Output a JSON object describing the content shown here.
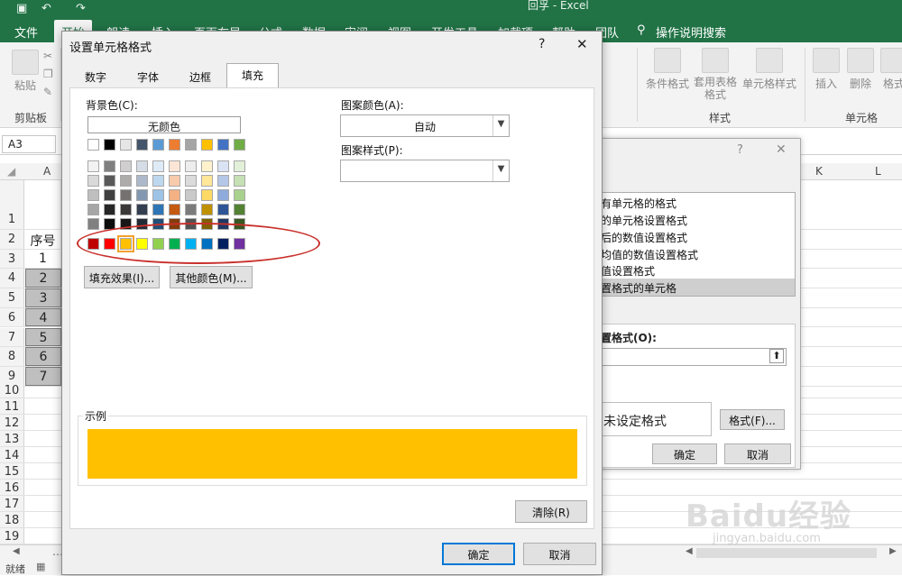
{
  "app": {
    "title": "回孚 - Excel"
  },
  "ribbon": {
    "tabs": [
      "文件",
      "开始",
      "朗读",
      "插入",
      "页面布局",
      "公式",
      "数据",
      "审阅",
      "视图",
      "开发工具",
      "加载项",
      "帮助",
      "团队"
    ],
    "active_tab": "开始",
    "search_label": "操作说明搜索",
    "clipboard": {
      "paste": "粘贴",
      "group": "剪贴板"
    },
    "styles": {
      "conditional": "条件格式",
      "table": "套用表格格式",
      "cell_styles": "单元格样式",
      "group": "样式"
    },
    "cells": {
      "insert": "插入",
      "delete": "删除",
      "format": "格式",
      "group": "单元格"
    }
  },
  "formula_bar": {
    "name_box": "A3"
  },
  "sheet": {
    "col_headers": [
      "A",
      "K",
      "L"
    ],
    "rows": [
      {
        "num": "1",
        "a": ""
      },
      {
        "num": "2",
        "a": "序号"
      },
      {
        "num": "3",
        "a": "1"
      },
      {
        "num": "4",
        "a": "2"
      },
      {
        "num": "5",
        "a": "3"
      },
      {
        "num": "6",
        "a": "4"
      },
      {
        "num": "7",
        "a": "5"
      },
      {
        "num": "8",
        "a": "6"
      },
      {
        "num": "9",
        "a": "7"
      },
      {
        "num": "10",
        "a": ""
      },
      {
        "num": "11",
        "a": ""
      },
      {
        "num": "12",
        "a": ""
      },
      {
        "num": "13",
        "a": ""
      },
      {
        "num": "14",
        "a": ""
      },
      {
        "num": "15",
        "a": ""
      },
      {
        "num": "16",
        "a": ""
      },
      {
        "num": "17",
        "a": ""
      },
      {
        "num": "18",
        "a": ""
      },
      {
        "num": "19",
        "a": ""
      }
    ],
    "status": "就绪"
  },
  "bg_dialog": {
    "rule_types": [
      "有单元格的格式",
      "的单元格设置格式",
      "后的数值设置格式",
      "均值的数值设置格式",
      "值设置格式",
      "置格式的单元格"
    ],
    "format_label": "置格式(O):",
    "preview_text": "未设定格式",
    "format_button": "格式(F)...",
    "ok": "确定",
    "cancel": "取消"
  },
  "dialog": {
    "title": "设置单元格格式",
    "help": "?",
    "close": "✕",
    "tabs": [
      "数字",
      "字体",
      "边框",
      "填充"
    ],
    "active_tab": "填充",
    "bg_color_label": "背景色(C):",
    "no_color": "无颜色",
    "theme_top": [
      "#ffffff",
      "#000000",
      "#e7e6e6",
      "#44546a",
      "#5b9bd5",
      "#ed7d31",
      "#a5a5a5",
      "#ffc000",
      "#4472c4",
      "#70ad47"
    ],
    "theme_shades": [
      [
        "#f2f2f2",
        "#7f7f7f",
        "#d0cece",
        "#d6dce5",
        "#deebf7",
        "#fbe5d6",
        "#ededed",
        "#fff2cc",
        "#dae3f3",
        "#e2f0d9"
      ],
      [
        "#d9d9d9",
        "#595959",
        "#aeabab",
        "#adb9ca",
        "#bdd7ee",
        "#f8cbad",
        "#dbdbdb",
        "#ffe699",
        "#b4c7e7",
        "#c5e0b4"
      ],
      [
        "#bfbfbf",
        "#404040",
        "#767171",
        "#8497b0",
        "#9dc3e6",
        "#f4b183",
        "#c9c9c9",
        "#ffd966",
        "#8faadc",
        "#a9d18e"
      ],
      [
        "#a6a6a6",
        "#262626",
        "#3b3838",
        "#333f50",
        "#2e75b6",
        "#c55a11",
        "#7b7b7b",
        "#bf9000",
        "#2f5597",
        "#548235"
      ],
      [
        "#808080",
        "#0d0d0d",
        "#171717",
        "#222a35",
        "#1f4e79",
        "#843c0c",
        "#525252",
        "#7f6000",
        "#203864",
        "#385723"
      ]
    ],
    "standard_colors": [
      "#c00000",
      "#ff0000",
      "#ffc000",
      "#ffff00",
      "#92d050",
      "#00b050",
      "#00b0f0",
      "#0070c0",
      "#002060",
      "#7030a0"
    ],
    "selected_color": "#ffc000",
    "fill_effects": "填充效果(I)...",
    "more_colors": "其他颜色(M)...",
    "pattern_color_label": "图案颜色(A):",
    "pattern_color_value": "自动",
    "pattern_style_label": "图案样式(P):",
    "sample_label": "示例",
    "clear": "清除(R)",
    "ok": "确定",
    "cancel": "取消"
  },
  "watermark": {
    "text": "Baidu经验",
    "url": "jingyan.baidu.com"
  }
}
